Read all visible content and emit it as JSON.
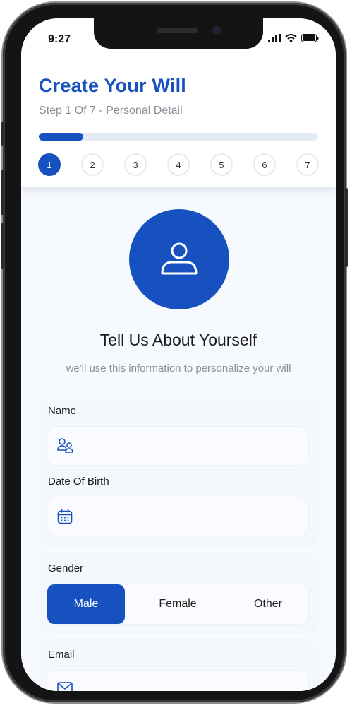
{
  "status_bar": {
    "time": "9:27"
  },
  "header": {
    "title": "Create Your Will",
    "subtitle": "Step 1 Of 7 - Personal Detail",
    "progress_fraction": 0.16,
    "steps": [
      "1",
      "2",
      "3",
      "4",
      "5",
      "6",
      "7"
    ],
    "active_step": 1
  },
  "intro": {
    "icon": "person-icon",
    "headline": "Tell Us About Yourself",
    "tagline": "we'll use this information to personalize your will"
  },
  "form": {
    "name": {
      "label": "Name",
      "value": "",
      "icon": "users-icon"
    },
    "dob": {
      "label": "Date Of Birth",
      "value": "",
      "icon": "calendar-icon"
    },
    "gender": {
      "label": "Gender",
      "options": [
        "Male",
        "Female",
        "Other"
      ],
      "selected": "Male"
    },
    "email": {
      "label": "Email",
      "value": "",
      "icon": "mail-icon"
    }
  },
  "colors": {
    "accent": "#1751bf",
    "background": "#f6f9fd",
    "muted_text": "#8a8f98"
  }
}
